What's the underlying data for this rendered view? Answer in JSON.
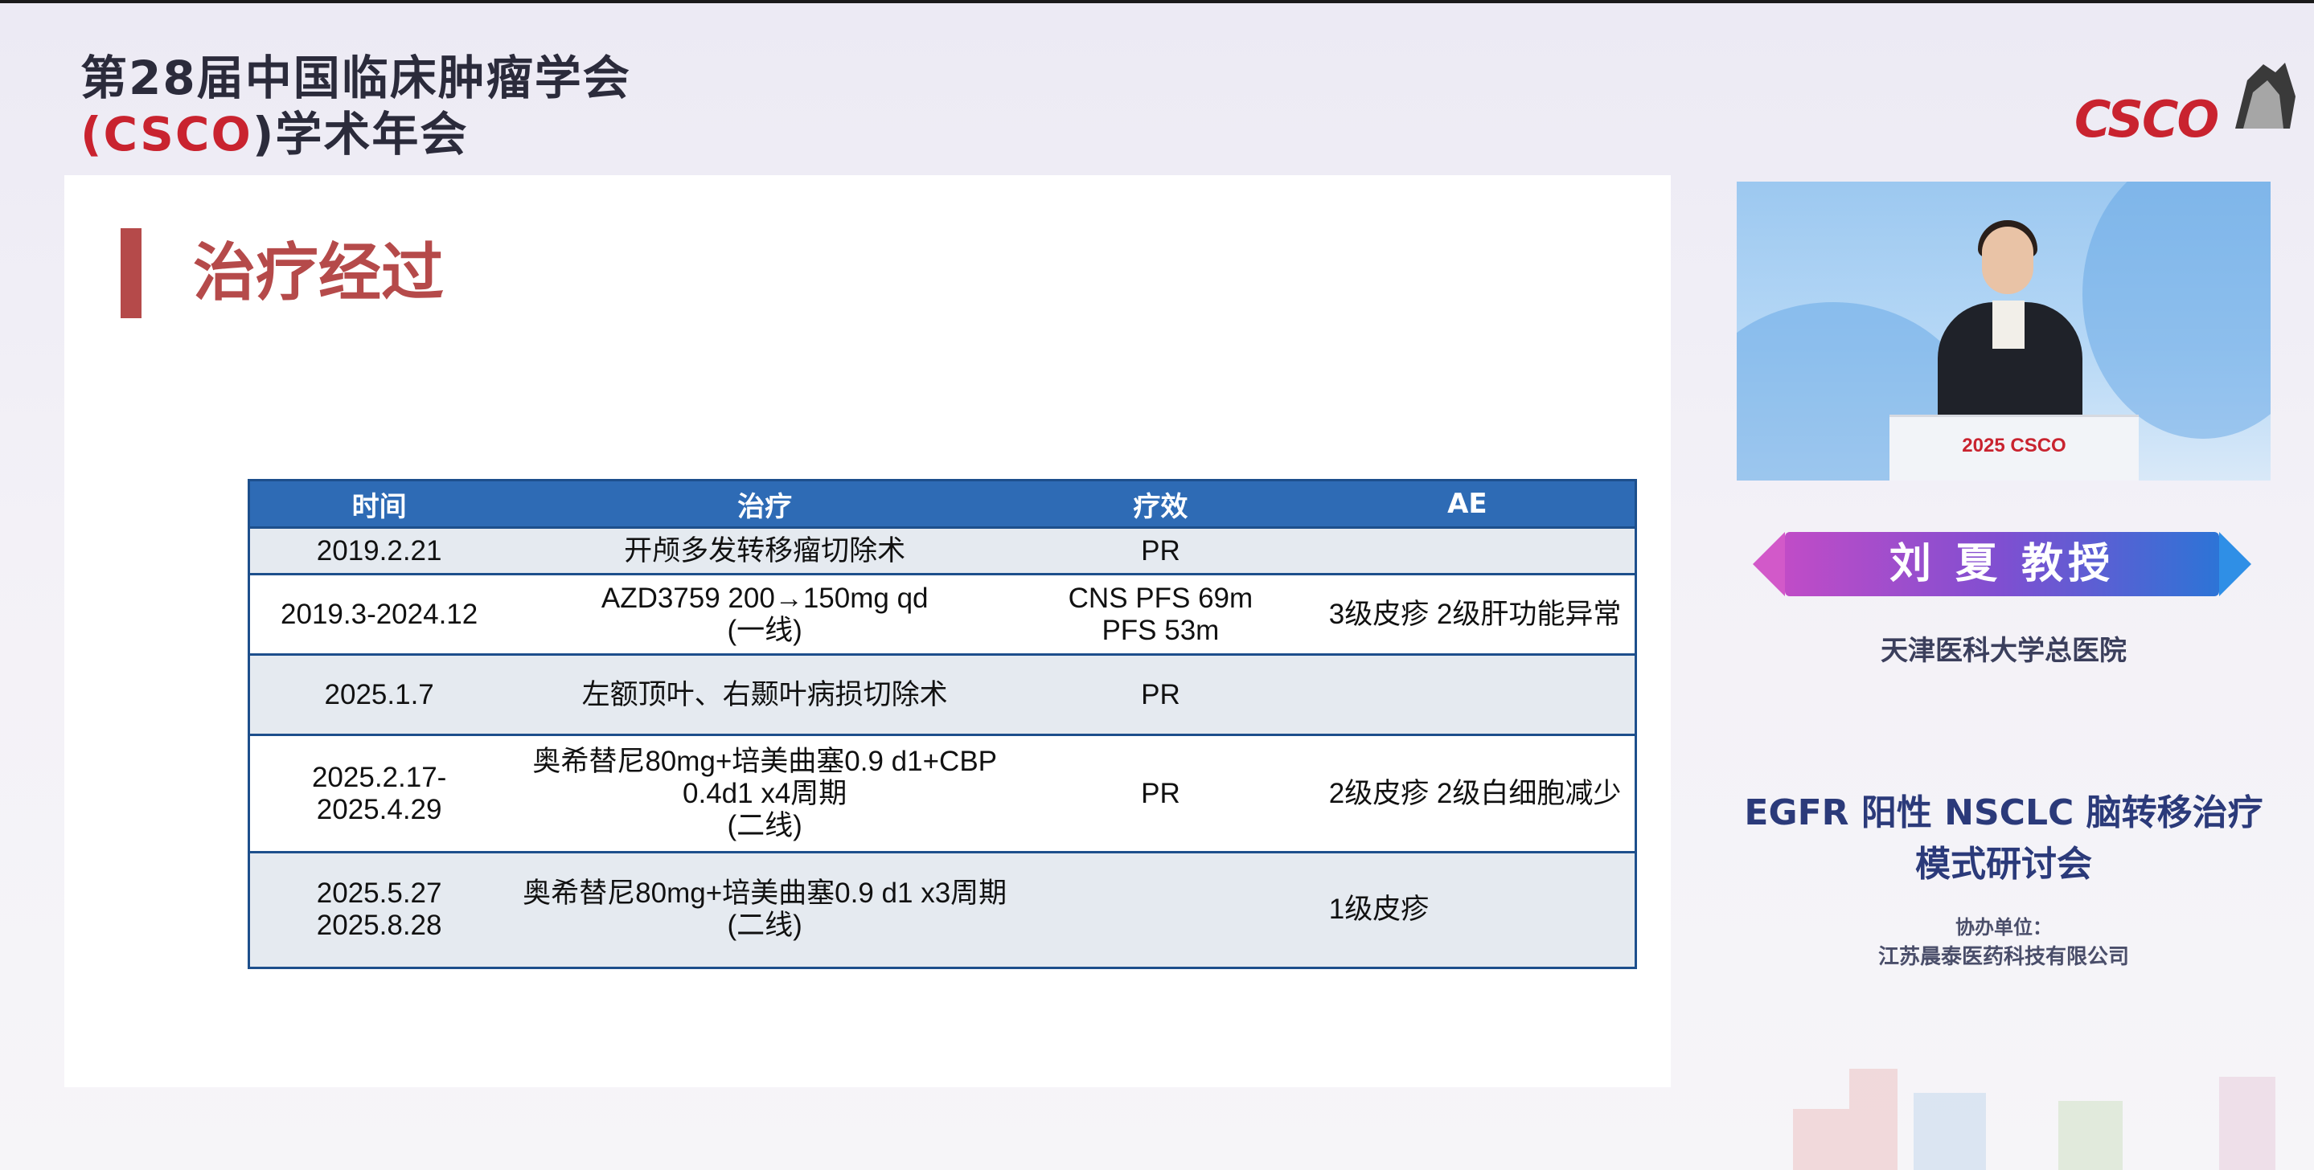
{
  "conference": {
    "line1": "第28届中国临床肿瘤学会",
    "line2_open": "(",
    "line2_csco": "CSCO",
    "line2_rest": ")学术年会"
  },
  "logo": {
    "text": "CSCO",
    "icon": "great-wall-logo"
  },
  "slide": {
    "title": "治疗经过",
    "table": {
      "headers": [
        "时间",
        "治疗",
        "疗效",
        "AE"
      ],
      "rows": [
        {
          "time": [
            "2019.2.21"
          ],
          "treatment": [
            "开颅多发转移瘤切除术"
          ],
          "effect": [
            "PR"
          ],
          "ae": ""
        },
        {
          "time": [
            "2019.3-2024.12"
          ],
          "treatment": [
            "AZD3759 200→150mg qd",
            "(一线)"
          ],
          "effect": [
            "CNS PFS  69m",
            "PFS 53m"
          ],
          "ae": "3级皮疹 2级肝功能异常"
        },
        {
          "time": [
            "2025.1.7"
          ],
          "treatment": [
            "左额顶叶、右颞叶病损切除术"
          ],
          "effect": [
            "PR"
          ],
          "ae": ""
        },
        {
          "time": [
            "2025.2.17-",
            "2025.4.29"
          ],
          "treatment": [
            "奥希替尼80mg+培美曲塞0.9 d1+CBP",
            "0.4d1 x4周期",
            "(二线)"
          ],
          "effect": [
            "PR"
          ],
          "ae": "2级皮疹 2级白细胞减少"
        },
        {
          "time": [
            "2025.5.27",
            "2025.8.28"
          ],
          "treatment": [
            "奥希替尼80mg+培美曲塞0.9 d1 x3周期",
            "(二线)"
          ],
          "effect": [
            ""
          ],
          "ae": "1级皮疹"
        }
      ]
    }
  },
  "sidebar": {
    "podium_text": "2025 CSCO",
    "speaker_name": "刘 夏 教授",
    "hospital": "天津医科大学总医院",
    "seminar_line1": "EGFR 阳性 NSCLC 脑转移治疗",
    "seminar_line2": "模式研讨会",
    "co_label": "协办单位：",
    "co_name": "江苏晨泰医药科技有限公司"
  },
  "colors": {
    "accent_red": "#b54a4a",
    "table_header": "#2e6bb5",
    "table_border": "#1d4f8c",
    "row_shade": "#e5eaf0",
    "csco_red": "#c9232f"
  }
}
